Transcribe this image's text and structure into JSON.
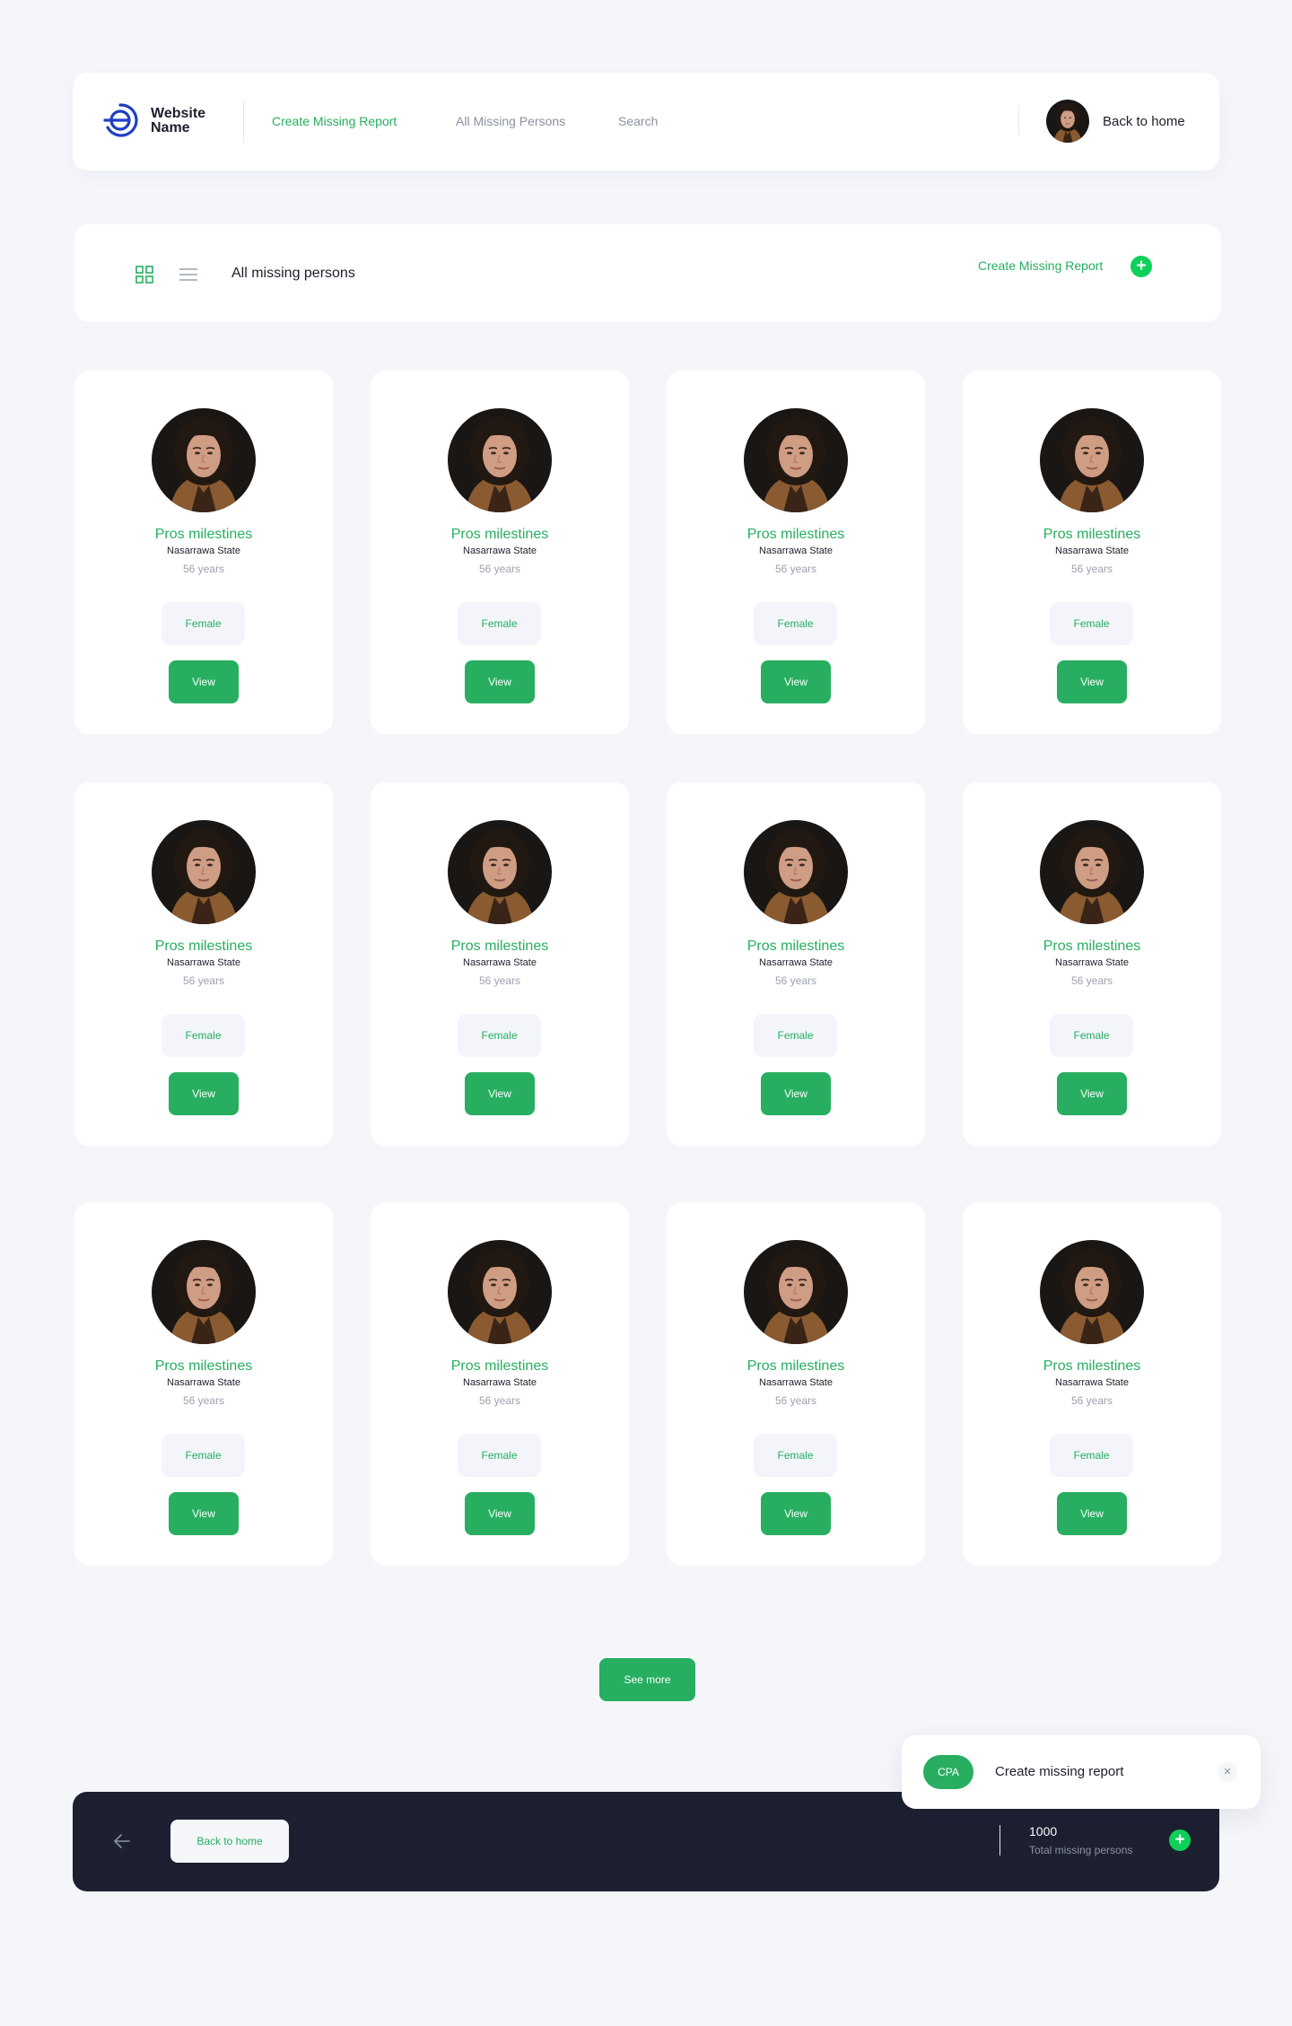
{
  "header": {
    "brand": "Website Name",
    "nav": [
      {
        "label": "Create Missing Report",
        "active": true
      },
      {
        "label": "All Missing Persons",
        "active": false
      },
      {
        "label": "Search",
        "active": false
      }
    ],
    "back_label": "Back to home"
  },
  "toolbar": {
    "title": "All missing persons",
    "create_label": "Create Missing Report"
  },
  "persons": [
    {
      "name": "Pros milestines",
      "state": "Nasarrawa State",
      "age": "56 years",
      "gender": "Female",
      "view": "View"
    },
    {
      "name": "Pros milestines",
      "state": "Nasarrawa State",
      "age": "56 years",
      "gender": "Female",
      "view": "View"
    },
    {
      "name": "Pros milestines",
      "state": "Nasarrawa State",
      "age": "56 years",
      "gender": "Female",
      "view": "View"
    },
    {
      "name": "Pros milestines",
      "state": "Nasarrawa State",
      "age": "56 years",
      "gender": "Female",
      "view": "View"
    },
    {
      "name": "Pros milestines",
      "state": "Nasarrawa State",
      "age": "56 years",
      "gender": "Female",
      "view": "View"
    },
    {
      "name": "Pros milestines",
      "state": "Nasarrawa State",
      "age": "56 years",
      "gender": "Female",
      "view": "View"
    },
    {
      "name": "Pros milestines",
      "state": "Nasarrawa State",
      "age": "56 years",
      "gender": "Female",
      "view": "View"
    },
    {
      "name": "Pros milestines",
      "state": "Nasarrawa State",
      "age": "56 years",
      "gender": "Female",
      "view": "View"
    },
    {
      "name": "Pros milestines",
      "state": "Nasarrawa State",
      "age": "56 years",
      "gender": "Female",
      "view": "View"
    },
    {
      "name": "Pros milestines",
      "state": "Nasarrawa State",
      "age": "56 years",
      "gender": "Female",
      "view": "View"
    },
    {
      "name": "Pros milestines",
      "state": "Nasarrawa State",
      "age": "56 years",
      "gender": "Female",
      "view": "View"
    },
    {
      "name": "Pros milestines",
      "state": "Nasarrawa State",
      "age": "56 years",
      "gender": "Female",
      "view": "View"
    }
  ],
  "see_more": "See more",
  "footer": {
    "back_label": "Back to home",
    "total_count": "1000",
    "total_label": "Total missing persons"
  },
  "toast": {
    "badge": "CPA",
    "text": "Create missing report",
    "close": "✕"
  },
  "colors": {
    "accent": "#27ae60",
    "accent_bright": "#0fd15a",
    "footer_bg": "#1c2030",
    "page_bg": "#f4f6fa",
    "logo_blue": "#1f3fc4"
  }
}
